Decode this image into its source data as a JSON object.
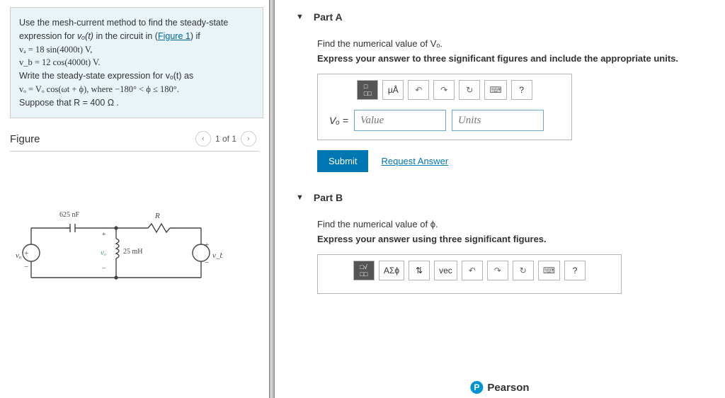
{
  "problem": {
    "intro": "Use the mesh-current method to find the steady-state expression for ",
    "var_vo": "vₒ(t)",
    "in_circuit": " in the circuit in (",
    "figure_link": "Figure 1",
    "if_text": ") if",
    "eq1_lhs": "vₐ = 18 sin(4000t) V,",
    "eq2_lhs": "v_b = 12 cos(4000t) V.",
    "write_expr": "Write the steady-state expression for vₒ(t) as",
    "eq3": "vₒ = Vₒ cos(ωt + ϕ), where −180° < ϕ ≤ 180°.",
    "suppose": "Suppose that R = 400  Ω ."
  },
  "figure": {
    "title": "Figure",
    "nav": "1 of 1",
    "c625": "625 nF",
    "r": "R",
    "l25": "25 mH",
    "va": "vₐ",
    "vo": "vₒ",
    "vb": "v_b"
  },
  "partA": {
    "title": "Part A",
    "inst1": "Find the numerical value of Vₒ.",
    "inst2": "Express your answer to three significant figures and include the appropriate units.",
    "label": "Vₒ = ",
    "value_ph": "Value",
    "units_ph": "Units",
    "submit": "Submit",
    "request": "Request Answer",
    "tb_ua": "µÅ",
    "tb_undo": "↶",
    "tb_redo": "↷",
    "tb_reset": "↻",
    "tb_kbd": "⌨",
    "tb_help": "?"
  },
  "partB": {
    "title": "Part B",
    "inst1": "Find the numerical value of ϕ.",
    "inst2": "Express your answer using three significant figures.",
    "tb_greek": "ΑΣϕ",
    "tb_updown": "⇅",
    "tb_vec": "vec",
    "tb_undo": "↶",
    "tb_redo": "↷",
    "tb_reset": "↻",
    "tb_kbd": "⌨",
    "tb_help": "?"
  },
  "footer": {
    "pearson": "Pearson",
    "p": "P"
  }
}
